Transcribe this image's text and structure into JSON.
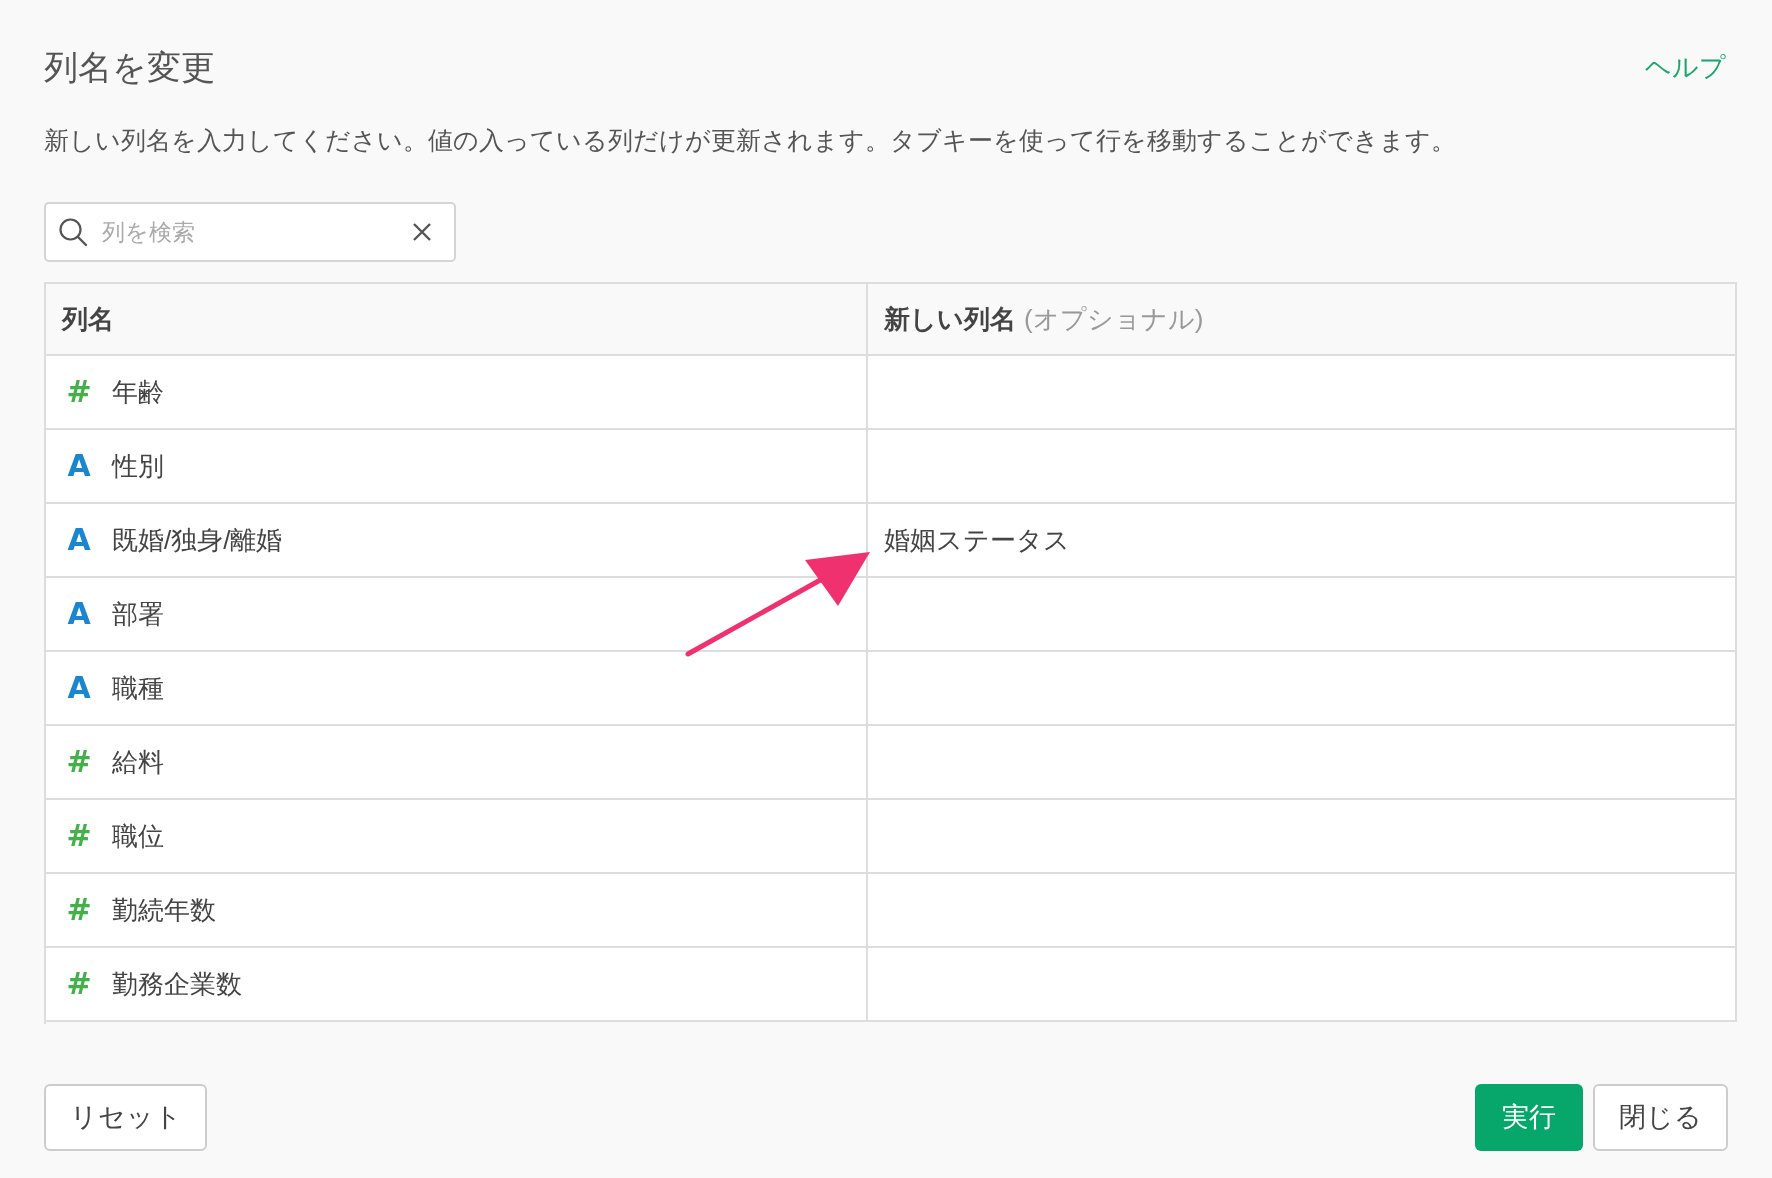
{
  "dialog": {
    "title": "列名を変更",
    "help_link": "ヘルプ",
    "description": "新しい列名を入力してください。値の入っている列だけが更新されます。タブキーを使って行を移動することができます。"
  },
  "search": {
    "placeholder": "列を検索"
  },
  "table": {
    "columns": [
      {
        "label": "列名"
      },
      {
        "label": "新しい列名",
        "hint": "(オプショナル)"
      }
    ],
    "rows": [
      {
        "kind": "number",
        "icon": "#",
        "name": "年齢"
      },
      {
        "kind": "text",
        "icon": "A",
        "name": "性別"
      },
      {
        "kind": "text",
        "icon": "A",
        "name": "既婚/独身/離婚",
        "new_name": "婚姻ステータス"
      },
      {
        "kind": "text",
        "icon": "A",
        "name": "部署"
      },
      {
        "kind": "text",
        "icon": "A",
        "name": "職種"
      },
      {
        "kind": "number",
        "icon": "#",
        "name": "給料"
      },
      {
        "kind": "number",
        "icon": "#",
        "name": "職位"
      },
      {
        "kind": "number",
        "icon": "#",
        "name": "勤続年数"
      },
      {
        "kind": "number",
        "icon": "#",
        "name": "勤務企業数"
      }
    ]
  },
  "buttons": {
    "reset": "リセット",
    "run": "実行",
    "close": "閉じる"
  }
}
